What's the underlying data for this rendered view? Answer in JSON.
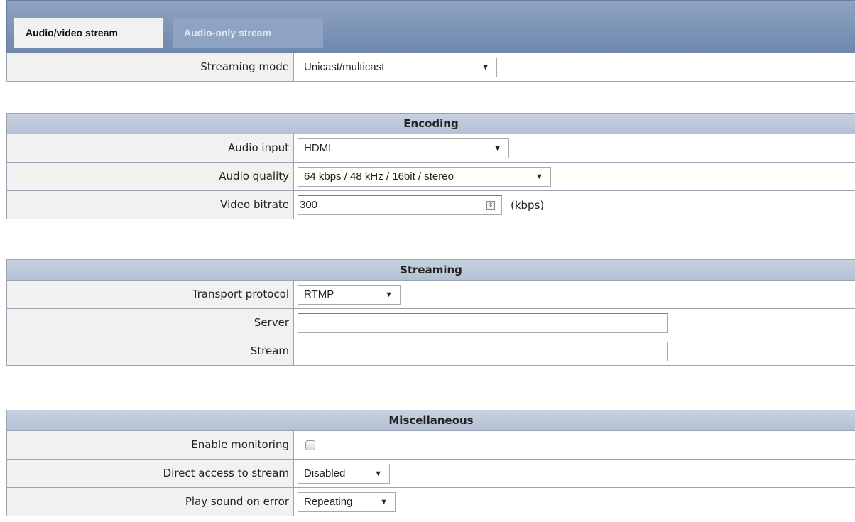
{
  "tabs": {
    "active": "Audio/video stream",
    "inactive": "Audio-only stream"
  },
  "top": {
    "streaming_mode": {
      "label": "Streaming mode",
      "value": "Unicast/multicast"
    }
  },
  "encoding": {
    "title": "Encoding",
    "audio_input": {
      "label": "Audio input",
      "value": "HDMI"
    },
    "audio_quality": {
      "label": "Audio quality",
      "value": "64 kbps / 48 kHz / 16bit / stereo"
    },
    "video_bitrate": {
      "label": "Video bitrate",
      "value": "300",
      "unit": "(kbps)"
    }
  },
  "streaming": {
    "title": "Streaming",
    "transport_protocol": {
      "label": "Transport protocol",
      "value": "RTMP"
    },
    "server": {
      "label": "Server",
      "value": ""
    },
    "stream": {
      "label": "Stream",
      "value": ""
    }
  },
  "misc": {
    "title": "Miscellaneous",
    "enable_monitoring": {
      "label": "Enable monitoring",
      "checked": false
    },
    "direct_access": {
      "label": "Direct access to stream",
      "value": "Disabled"
    },
    "play_sound": {
      "label": "Play sound on error",
      "value": "Repeating"
    }
  },
  "icons": {
    "dropdown": "chevron-down-icon",
    "spinner": "spinner-icon"
  }
}
